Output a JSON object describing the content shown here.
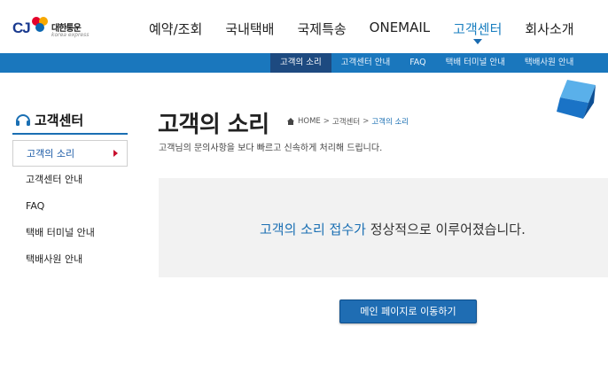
{
  "logo": {
    "brand": "CJ",
    "korean": "대한통운",
    "english": "korea express"
  },
  "gnb": {
    "items": [
      {
        "label": "예약/조회"
      },
      {
        "label": "국내택배"
      },
      {
        "label": "국제특송"
      },
      {
        "label": "ONEMAIL"
      },
      {
        "label": "고객센터",
        "active": true
      },
      {
        "label": "회사소개"
      }
    ]
  },
  "subnav": {
    "items": [
      {
        "label": "고객의 소리",
        "active": true
      },
      {
        "label": "고객센터 안내"
      },
      {
        "label": "FAQ"
      },
      {
        "label": "택배 터미널 안내"
      },
      {
        "label": "택배사원 안내"
      }
    ]
  },
  "sidebar": {
    "title": "고객센터",
    "items": [
      {
        "label": "고객의 소리",
        "active": true
      },
      {
        "label": "고객센터 안내"
      },
      {
        "label": "FAQ"
      },
      {
        "label": "택배 터미널 안내"
      },
      {
        "label": "택배사원 안내"
      }
    ]
  },
  "main": {
    "title": "고객의 소리",
    "breadcrumb": {
      "home": "HOME",
      "sep1": ">",
      "level1": "고객센터",
      "sep2": ">",
      "current": "고객의 소리"
    },
    "description": "고객님의 문의사항을 보다 빠르고 신속하게 처리해 드립니다.",
    "message_highlight": "고객의 소리 접수가",
    "message_rest": " 정상적으로 이루어졌습니다.",
    "button_label": "메인 페이지로 이동하기"
  },
  "colors": {
    "accent": "#1a77bd",
    "subnav_active": "#1d4a80",
    "highlight_text": "#1a6fb3",
    "active_marker": "#c8102e"
  },
  "icons": {
    "sidebar_title": "headset-icon",
    "breadcrumb_home": "home-icon",
    "gnb_active": "caret-down-icon",
    "sidebar_active": "caret-right-icon",
    "decoration": "cube-icon"
  }
}
